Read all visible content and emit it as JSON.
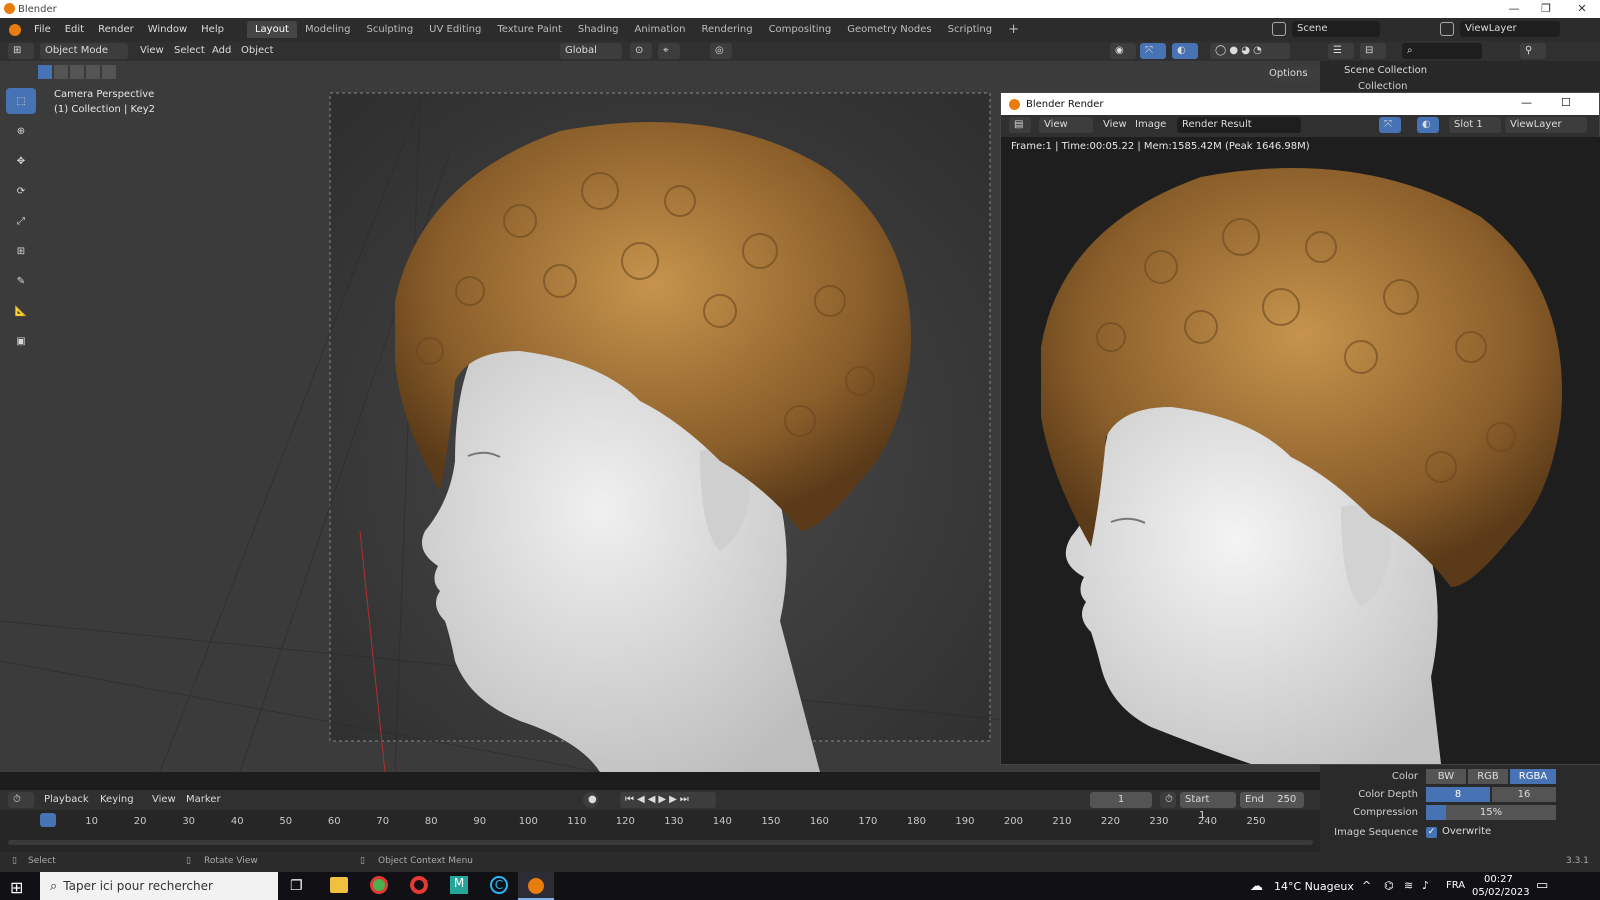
{
  "window": {
    "title": "Blender"
  },
  "menu": {
    "items": [
      "File",
      "Edit",
      "Render",
      "Window",
      "Help"
    ],
    "workspaces": [
      "Layout",
      "Modeling",
      "Sculpting",
      "UV Editing",
      "Texture Paint",
      "Shading",
      "Animation",
      "Rendering",
      "Compositing",
      "Geometry Nodes",
      "Scripting"
    ],
    "add_tab": "+",
    "scene": "Scene",
    "viewlayer": "ViewLayer"
  },
  "header": {
    "mode": "Object Mode",
    "menus": [
      "View",
      "Select",
      "Add",
      "Object"
    ],
    "orientation": "Global",
    "options": "Options"
  },
  "viewport": {
    "camera_label": "Camera Perspective",
    "collection_label": "(1) Collection | Key2"
  },
  "outliner": {
    "scene_collection": "Scene Collection",
    "collection": "Collection"
  },
  "render_window": {
    "title": "Blender Render",
    "menus": [
      "View",
      "View",
      "Image"
    ],
    "result": "Render Result",
    "slot": "Slot 1",
    "viewlayer": "ViewLayer",
    "frame_info": "Frame:1 | Time:00:05.22 | Mem:1585.42M (Peak 1646.98M)"
  },
  "properties": {
    "color_label": "Color",
    "color_options": [
      "BW",
      "RGB",
      "RGBA"
    ],
    "color_selected": "RGBA",
    "depth_label": "Color Depth",
    "depth_options": [
      "8",
      "16"
    ],
    "depth_selected": "8",
    "compression_label": "Compression",
    "compression_value": "15%",
    "compression_fraction": 0.15,
    "sequence_label": "Image Sequence",
    "overwrite_label": "Overwrite",
    "overwrite_checked": true
  },
  "timeline": {
    "menus": [
      "Playback",
      "Keying",
      "View",
      "Marker"
    ],
    "current_frame": "1",
    "start_label": "Start",
    "start_value": "1",
    "end_label": "End",
    "end_value": "250",
    "ticks": [
      "1",
      "10",
      "20",
      "30",
      "40",
      "50",
      "60",
      "70",
      "80",
      "90",
      "100",
      "110",
      "120",
      "130",
      "140",
      "150",
      "160",
      "170",
      "180",
      "190",
      "200",
      "210",
      "220",
      "230",
      "240",
      "250"
    ]
  },
  "statusbar": {
    "select": "Select",
    "rotate": "Rotate View",
    "context": "Object Context Menu",
    "version": "3.3.1"
  },
  "taskbar": {
    "search_placeholder": "Taper ici pour rechercher",
    "weather": "14°C Nuageux",
    "lang": "FRA",
    "time": "00:27",
    "date": "05/02/2023"
  },
  "colors": {
    "accent": "#4772b3",
    "hair": "#a07438",
    "skin": "#dcdcdc",
    "bg": "#3a3a3a"
  }
}
